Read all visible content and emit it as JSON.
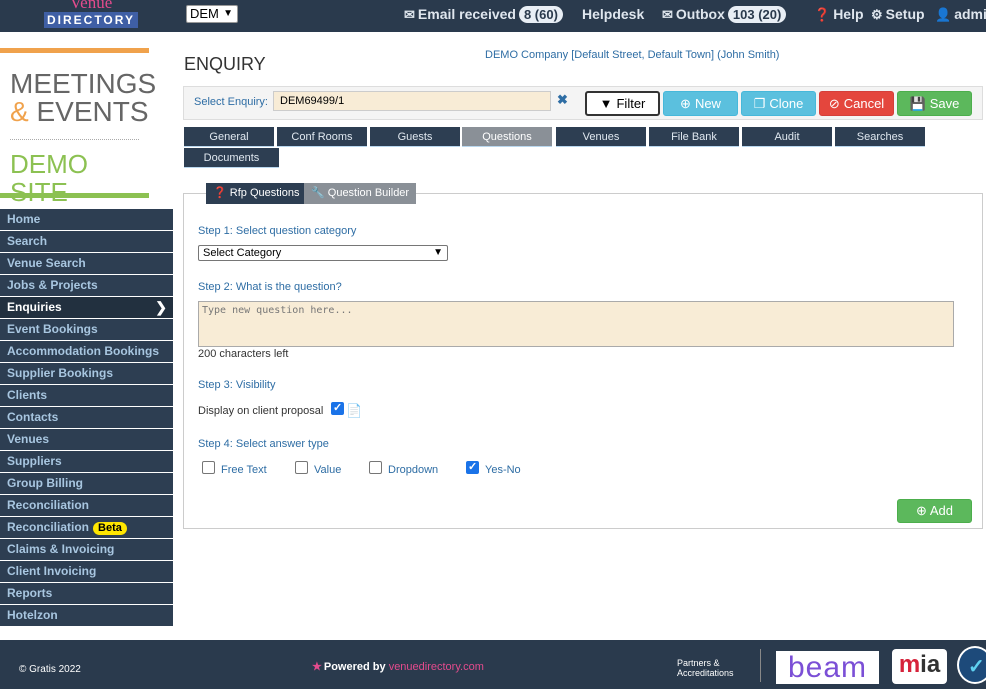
{
  "topbar": {
    "logo_top": "Venue",
    "logo_bottom": "DIRECTORY",
    "company_select": "DEM",
    "email_label": "Email received",
    "email_count": "8 (60)",
    "helpdesk": "Helpdesk",
    "outbox_label": "Outbox",
    "outbox_count": "103 (20)",
    "help": "Help",
    "setup": "Setup",
    "user": "admin"
  },
  "brand": {
    "line1": "MEETINGS",
    "amp": "&",
    "line2": "EVENTS",
    "line3": "DEMO SITE"
  },
  "sidebar": {
    "items": [
      {
        "label": "Home"
      },
      {
        "label": "Search"
      },
      {
        "label": "Venue Search"
      },
      {
        "label": "Jobs & Projects"
      },
      {
        "label": "Enquiries"
      },
      {
        "label": "Event Bookings"
      },
      {
        "label": "Accommodation Bookings"
      },
      {
        "label": "Supplier Bookings"
      },
      {
        "label": "Clients"
      },
      {
        "label": "Contacts"
      },
      {
        "label": "Venues"
      },
      {
        "label": "Suppliers"
      },
      {
        "label": "Group Billing"
      },
      {
        "label": "Reconciliation"
      },
      {
        "label": "Reconciliation",
        "badge": "Beta"
      },
      {
        "label": "Claims & Invoicing"
      },
      {
        "label": "Client Invoicing"
      },
      {
        "label": "Reports"
      },
      {
        "label": "Hotelzon"
      }
    ]
  },
  "main": {
    "title": "ENQUIRY",
    "company_line": "DEMO Company [Default Street, Default Town] (John Smith)",
    "select_label": "Select Enquiry:",
    "enquiry_value": "DEM69499/1",
    "clear_glyph": "✖",
    "buttons": {
      "filter": "Filter",
      "new": "New",
      "clone": "Clone",
      "cancel": "Cancel",
      "save": "Save"
    },
    "tabs": [
      {
        "label": "General"
      },
      {
        "label": "Conf Rooms"
      },
      {
        "label": "Guests"
      },
      {
        "label": "Questions"
      },
      {
        "label": "Venues"
      },
      {
        "label": "File Bank"
      },
      {
        "label": "Audit"
      },
      {
        "label": "Searches"
      },
      {
        "label": "Documents"
      }
    ],
    "subtabs": {
      "rfp": "Rfp Questions",
      "builder": "Question Builder"
    },
    "step1": "Step 1: Select question category",
    "category_value": "Select Category",
    "step2": "Step 2: What is the question?",
    "question_placeholder": "Type new question here...",
    "chars_left": "200 characters left",
    "step3": "Step 3: Visibility",
    "visibility_label": "Display on client proposal",
    "step4": "Step 4: Select answer type",
    "answer_types": {
      "free_text": "Free Text",
      "value": "Value",
      "dropdown": "Dropdown",
      "yes_no": "Yes-No"
    },
    "add_button": "Add"
  },
  "footer": {
    "copyright": "© Gratis 2022",
    "powered_by": "Powered by",
    "powered_link": "venuedirectory.com",
    "partners_line1": "Partners &",
    "partners_line2": "Accreditations",
    "beam": "beam",
    "mia_m": "m",
    "mia_ia": "ia"
  },
  "colors": {
    "topbar": "#2a3a4d",
    "sidebar": "#2d3e52",
    "accent_blue": "#2e6da4",
    "success": "#5cb85c",
    "danger": "#e4463d",
    "info": "#5bc0de",
    "input_bg": "#f8ecd6"
  }
}
